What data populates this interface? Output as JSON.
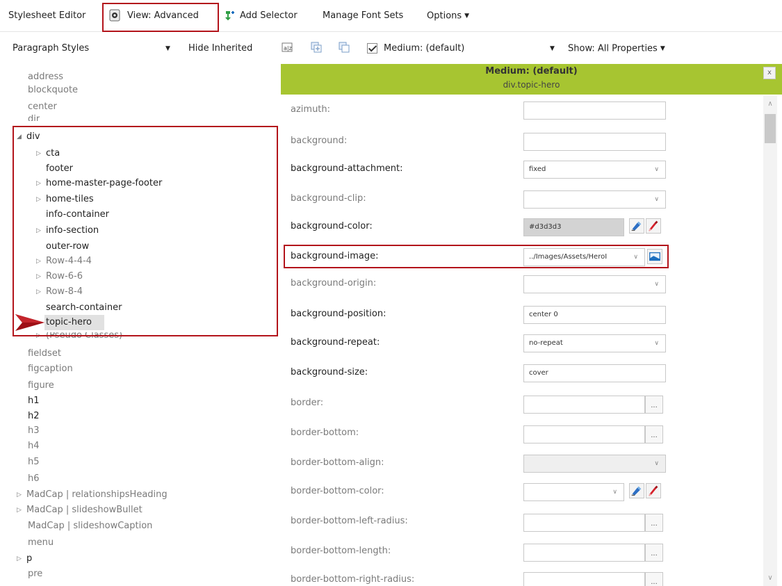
{
  "toolbar": {
    "stylesheet_editor": "Stylesheet Editor",
    "view_advanced": "View: Advanced",
    "add_selector": "Add Selector",
    "manage_font_sets": "Manage Font Sets",
    "options": "Options"
  },
  "toolbar2": {
    "styles_dropdown": "Paragraph Styles",
    "hide_inherited": "Hide Inherited",
    "medium_checked": true,
    "medium": "Medium: (default)",
    "show": "Show: All Properties"
  },
  "tree": {
    "items": [
      {
        "label": "address"
      },
      {
        "label": "blockquote"
      },
      {
        "label": "center"
      },
      {
        "label": "dir"
      },
      {
        "label": "div"
      },
      {
        "label": "cta"
      },
      {
        "label": "footer"
      },
      {
        "label": "home-master-page-footer"
      },
      {
        "label": "home-tiles"
      },
      {
        "label": "info-container"
      },
      {
        "label": "info-section"
      },
      {
        "label": "outer-row"
      },
      {
        "label": "Row-4-4-4"
      },
      {
        "label": "Row-6-6"
      },
      {
        "label": "Row-8-4"
      },
      {
        "label": "search-container"
      },
      {
        "label": "topic-hero"
      },
      {
        "label": "(Pseudo Classes)"
      },
      {
        "label": "fieldset"
      },
      {
        "label": "figcaption"
      },
      {
        "label": "figure"
      },
      {
        "label": "h1"
      },
      {
        "label": "h2"
      },
      {
        "label": "h3"
      },
      {
        "label": "h4"
      },
      {
        "label": "h5"
      },
      {
        "label": "h6"
      },
      {
        "label": "MadCap | relationshipsHeading"
      },
      {
        "label": "MadCap | slideshowBullet"
      },
      {
        "label": "MadCap | slideshowCaption"
      },
      {
        "label": "menu"
      },
      {
        "label": "p"
      },
      {
        "label": "pre"
      }
    ]
  },
  "panel": {
    "title": "Medium: (default)",
    "subtitle": "div.topic-hero",
    "close": "x",
    "properties": [
      {
        "label": "azimuth:",
        "value": ""
      },
      {
        "label": "background:",
        "value": ""
      },
      {
        "label": "background-attachment:",
        "value": "fixed"
      },
      {
        "label": "background-clip:",
        "value": ""
      },
      {
        "label": "background-color:",
        "value": "#d3d3d3"
      },
      {
        "label": "background-image:",
        "value": "../Images/Assets/HeroI"
      },
      {
        "label": "background-origin:",
        "value": ""
      },
      {
        "label": "background-position:",
        "value": "center 0"
      },
      {
        "label": "background-repeat:",
        "value": "no-repeat"
      },
      {
        "label": "background-size:",
        "value": "cover"
      },
      {
        "label": "border:",
        "value": ""
      },
      {
        "label": "border-bottom:",
        "value": ""
      },
      {
        "label": "border-bottom-align:",
        "value": ""
      },
      {
        "label": "border-bottom-color:",
        "value": ""
      },
      {
        "label": "border-bottom-left-radius:",
        "value": ""
      },
      {
        "label": "border-bottom-length:",
        "value": ""
      },
      {
        "label": "border-bottom-right-radius:",
        "value": ""
      }
    ]
  },
  "colors": {
    "accent_green": "#a7c531",
    "highlight_red": "#b3141b",
    "swatch_gray": "#d3d3d3"
  }
}
